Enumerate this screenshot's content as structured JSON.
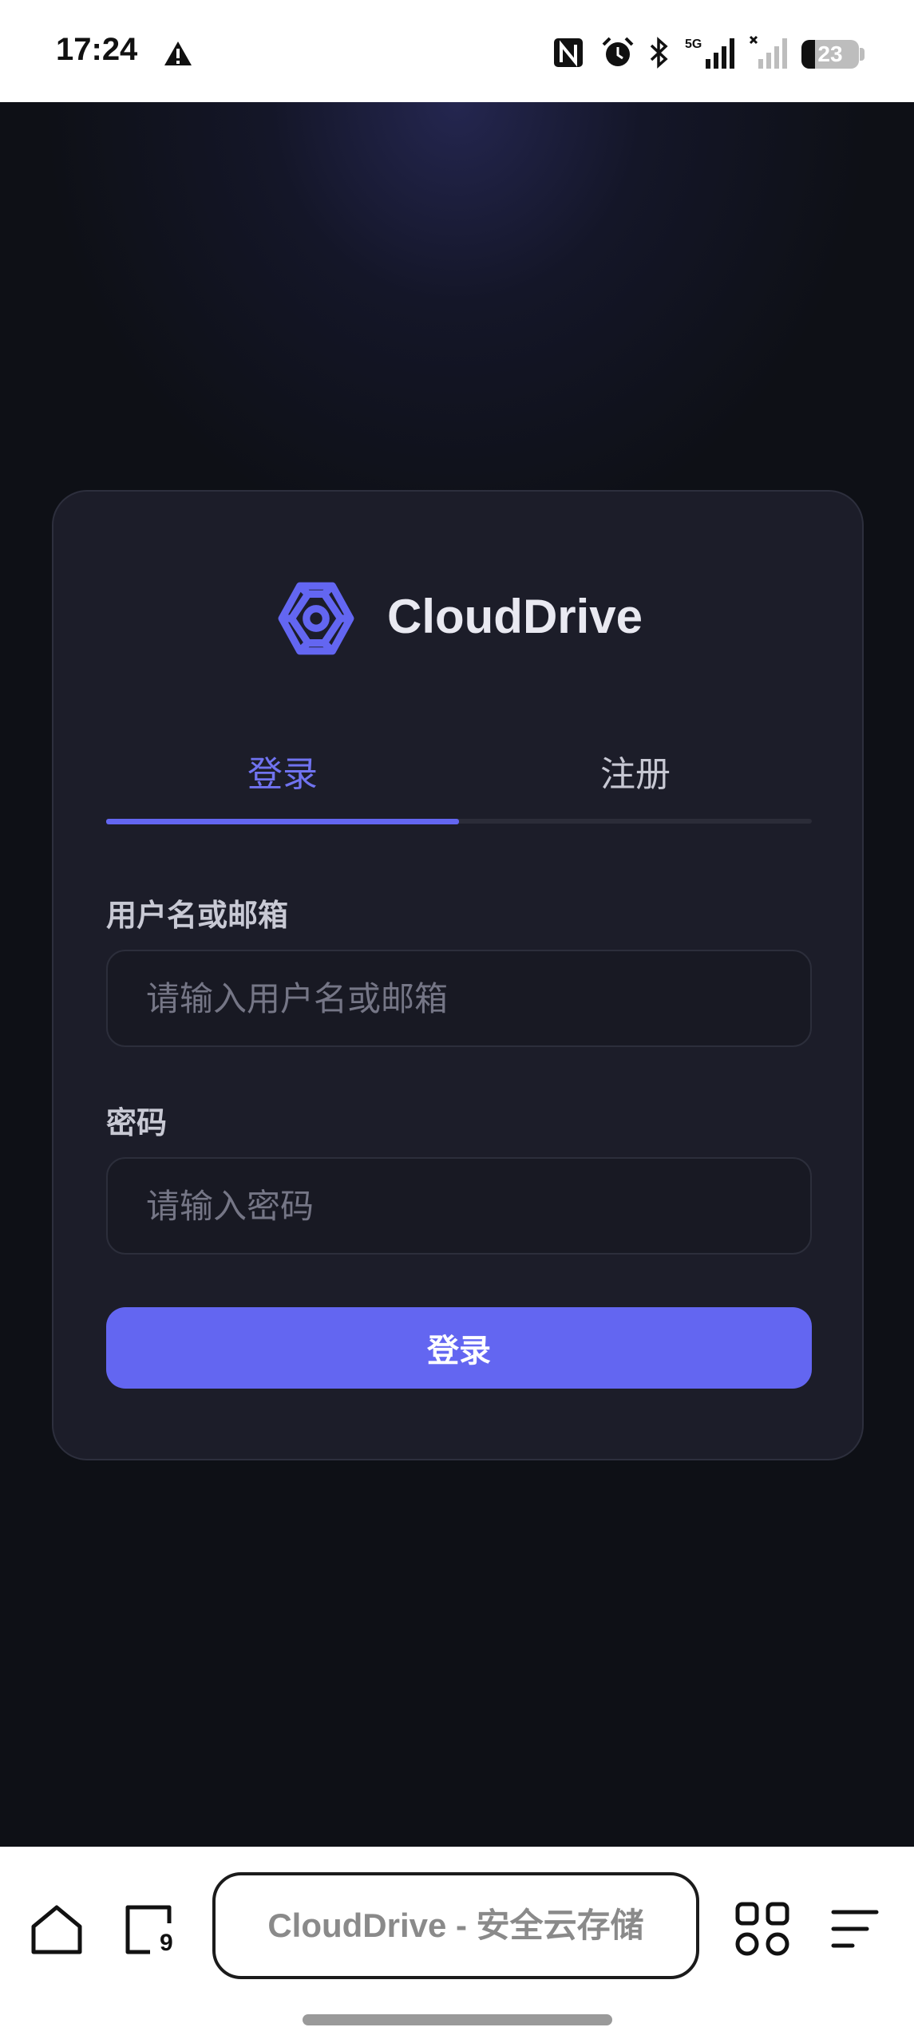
{
  "status_bar": {
    "time": "17:24",
    "battery_level": "23",
    "icons": [
      "warning-icon",
      "nfc-icon",
      "alarm-icon",
      "bluetooth-icon",
      "signal-5g-icon",
      "signal-no-sim-icon",
      "battery-icon"
    ]
  },
  "brand": {
    "name": "CloudDrive",
    "logo_icon": "gear-logo-icon",
    "accent_color": "#6366f1"
  },
  "tabs": [
    {
      "label": "登录",
      "active": true
    },
    {
      "label": "注册",
      "active": false
    }
  ],
  "form": {
    "username_label": "用户名或邮箱",
    "username_placeholder": "请输入用户名或邮箱",
    "username_value": "",
    "password_label": "密码",
    "password_placeholder": "请输入密码",
    "password_value": "",
    "submit_label": "登录"
  },
  "browser_bar": {
    "url_title": "CloudDrive - 安全云存储",
    "tab_count": "9",
    "icons": [
      "home-icon",
      "tabs-icon",
      "grid-icon",
      "menu-icon"
    ]
  },
  "colors": {
    "background": "#0e1016",
    "card": "#1c1d29",
    "accent": "#6366f1",
    "inactive_tab_text": "#c7c8d3"
  }
}
